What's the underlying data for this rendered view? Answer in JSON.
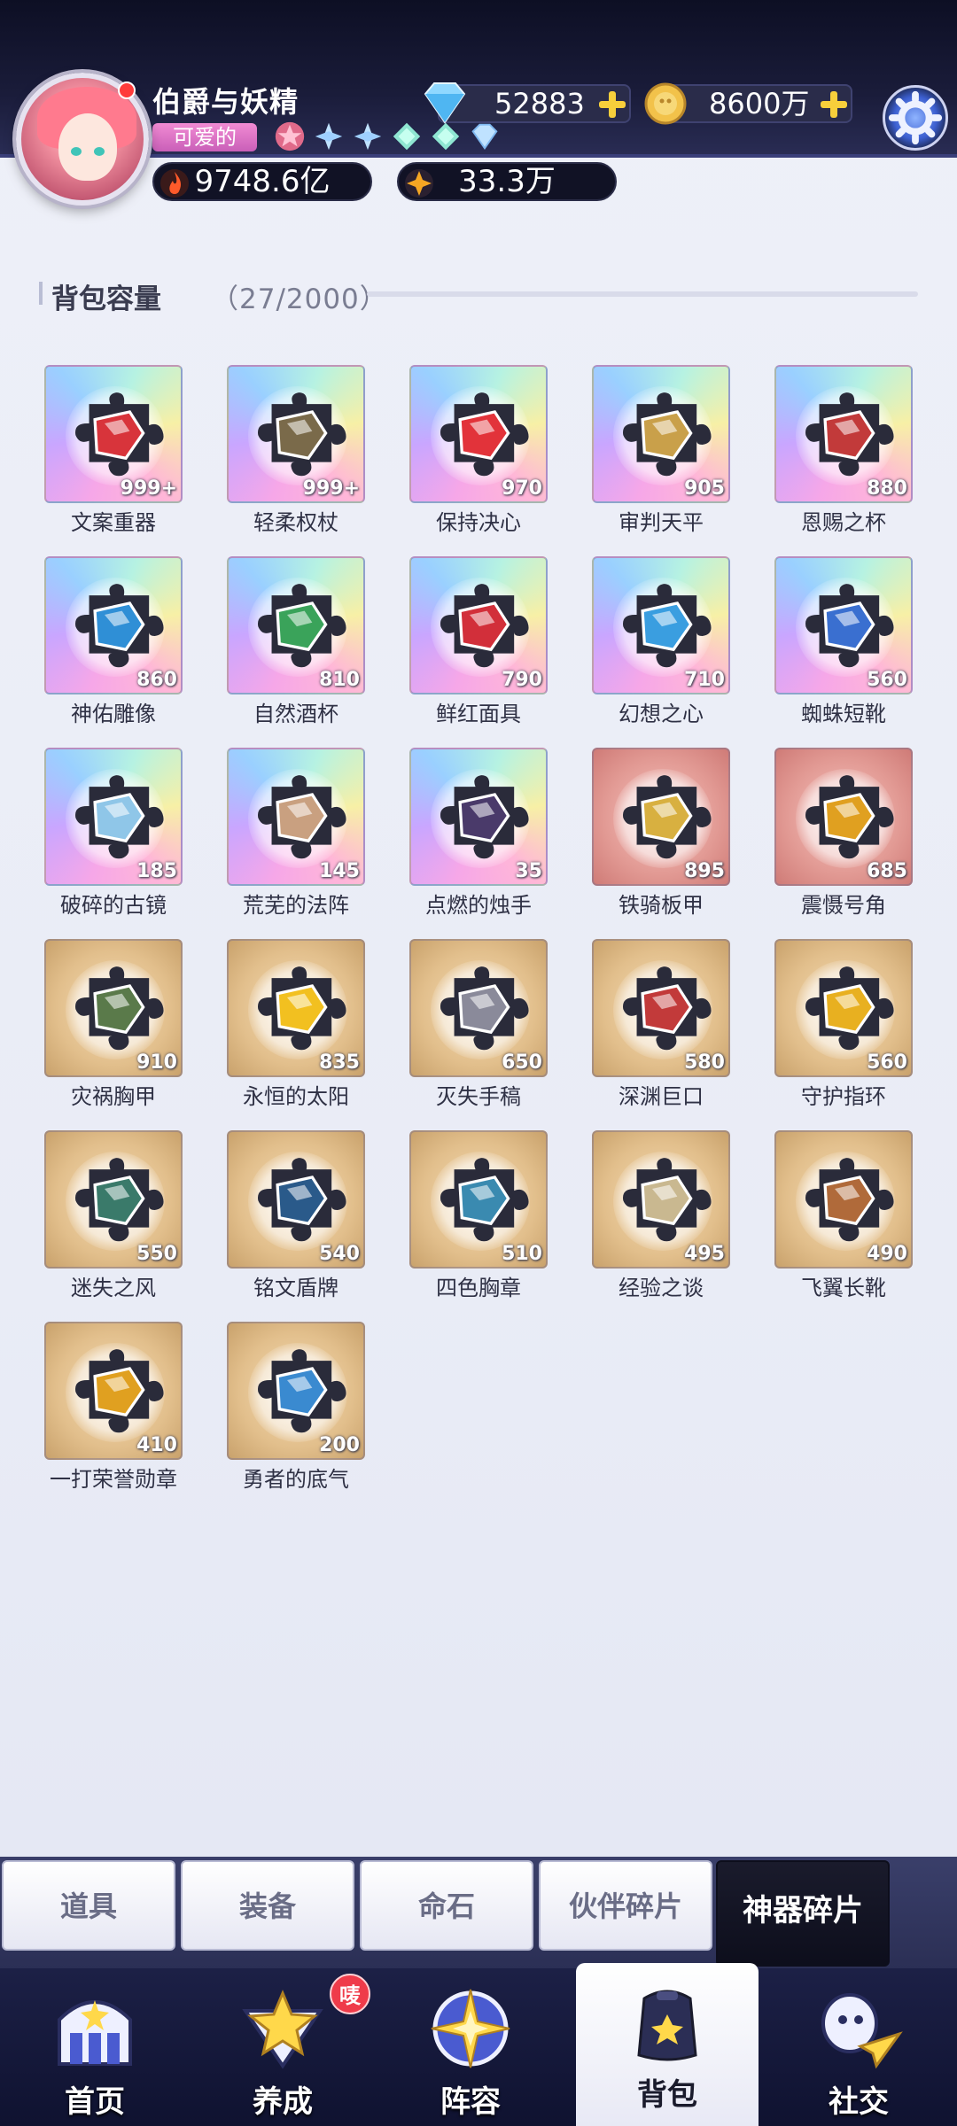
{
  "player": {
    "name": "伯爵与妖精",
    "title": "可爱的",
    "combat_power": "9748.6亿",
    "secondary_stat": "33.3万"
  },
  "currencies": {
    "diamonds": "52883",
    "gold": "8600万"
  },
  "inventory": {
    "capacity_label": "背包容量",
    "capacity_count": "（27/2000）",
    "items": [
      {
        "name": "文案重器",
        "qty": "999+",
        "rarity": "purple",
        "color": "#d8343b"
      },
      {
        "name": "轻柔权杖",
        "qty": "999+",
        "rarity": "purple",
        "color": "#7a6a4a"
      },
      {
        "name": "保持决心",
        "qty": "970",
        "rarity": "purple",
        "color": "#e2333a"
      },
      {
        "name": "审判天平",
        "qty": "905",
        "rarity": "purple",
        "color": "#c9a04a"
      },
      {
        "name": "恩赐之杯",
        "qty": "880",
        "rarity": "purple",
        "color": "#c23a3a"
      },
      {
        "name": "神佑雕像",
        "qty": "860",
        "rarity": "purple",
        "color": "#2f8fd6"
      },
      {
        "name": "自然酒杯",
        "qty": "810",
        "rarity": "purple",
        "color": "#3aa35a"
      },
      {
        "name": "鲜红面具",
        "qty": "790",
        "rarity": "purple",
        "color": "#d22f3a"
      },
      {
        "name": "幻想之心",
        "qty": "710",
        "rarity": "purple",
        "color": "#3a9ee0"
      },
      {
        "name": "蜘蛛短靴",
        "qty": "560",
        "rarity": "purple",
        "color": "#3a6fd0"
      },
      {
        "name": "破碎的古镜",
        "qty": "185",
        "rarity": "purple",
        "color": "#8fc6e8"
      },
      {
        "name": "荒芜的法阵",
        "qty": "145",
        "rarity": "purple",
        "color": "#c9a080"
      },
      {
        "name": "点燃的烛手",
        "qty": "35",
        "rarity": "purple",
        "color": "#4a3a6a"
      },
      {
        "name": "铁骑板甲",
        "qty": "895",
        "rarity": "red",
        "color": "#d8b040"
      },
      {
        "name": "震慑号角",
        "qty": "685",
        "rarity": "red",
        "color": "#e0a020"
      },
      {
        "name": "灾祸胸甲",
        "qty": "910",
        "rarity": "gold",
        "color": "#5a7a4a"
      },
      {
        "name": "永恒的太阳",
        "qty": "835",
        "rarity": "gold",
        "color": "#f2c020"
      },
      {
        "name": "灭失手稿",
        "qty": "650",
        "rarity": "gold",
        "color": "#8a8a9a"
      },
      {
        "name": "深渊巨口",
        "qty": "580",
        "rarity": "gold",
        "color": "#c23a3a"
      },
      {
        "name": "守护指环",
        "qty": "560",
        "rarity": "gold",
        "color": "#e8b020"
      },
      {
        "name": "迷失之风",
        "qty": "550",
        "rarity": "gold",
        "color": "#3a7a6a"
      },
      {
        "name": "铭文盾牌",
        "qty": "540",
        "rarity": "gold",
        "color": "#2a5a8a"
      },
      {
        "name": "四色胸章",
        "qty": "510",
        "rarity": "gold",
        "color": "#3a8ab0"
      },
      {
        "name": "经验之谈",
        "qty": "495",
        "rarity": "gold",
        "color": "#c9b890"
      },
      {
        "name": "飞翼长靴",
        "qty": "490",
        "rarity": "gold",
        "color": "#b06a3a"
      },
      {
        "name": "一打荣誉勋章",
        "qty": "410",
        "rarity": "gold",
        "color": "#e0a020"
      },
      {
        "name": "勇者的底气",
        "qty": "200",
        "rarity": "gold",
        "color": "#3a8ad0"
      }
    ]
  },
  "category_tabs": [
    {
      "label": "道具",
      "active": false
    },
    {
      "label": "装备",
      "active": false
    },
    {
      "label": "命石",
      "active": false
    },
    {
      "label": "伙伴碎片",
      "active": false
    },
    {
      "label": "神器碎片",
      "active": true
    }
  ],
  "nav": {
    "items": [
      {
        "label": "首页",
        "icon": "home-icon",
        "active": false
      },
      {
        "label": "养成",
        "icon": "star-icon",
        "active": false
      },
      {
        "label": "阵容",
        "icon": "compass-star-icon",
        "active": false
      },
      {
        "label": "背包",
        "icon": "backpack-icon",
        "active": true
      },
      {
        "label": "社交",
        "icon": "social-icon",
        "active": false
      }
    ],
    "notification_badge": "唛"
  }
}
